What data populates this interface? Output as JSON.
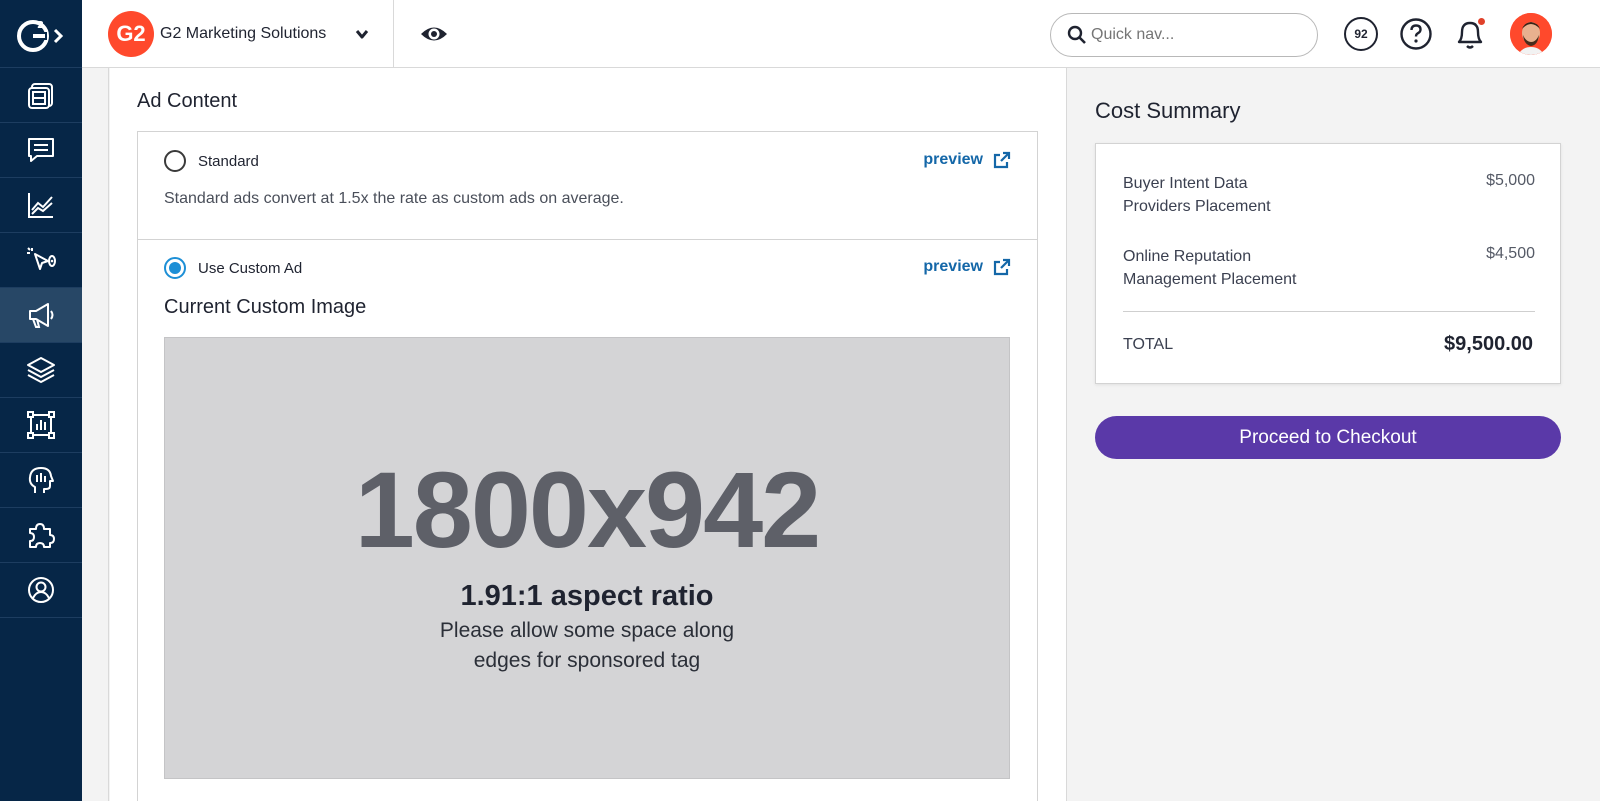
{
  "header": {
    "org_name": "G2 Marketing Solutions",
    "org_logo_text": "G2",
    "search_placeholder": "Quick nav...",
    "score_badge": "92",
    "notification_dot": true
  },
  "sidebar": {
    "logo": "G2",
    "items": [
      {
        "icon": "dashboard-icon",
        "active": false
      },
      {
        "icon": "chat-icon",
        "active": false
      },
      {
        "icon": "line-chart-icon",
        "active": false
      },
      {
        "icon": "click-target-icon",
        "active": false
      },
      {
        "icon": "megaphone-icon",
        "active": true
      },
      {
        "icon": "layers-icon",
        "active": false
      },
      {
        "icon": "report-chart-icon",
        "active": false
      },
      {
        "icon": "head-insight-icon",
        "active": false
      },
      {
        "icon": "puzzle-icon",
        "active": false
      },
      {
        "icon": "user-circle-icon",
        "active": false
      }
    ]
  },
  "main": {
    "section_title": "Ad Content",
    "standard": {
      "label": "Standard",
      "preview": "preview",
      "description": "Standard ads convert at 1.5x the rate as custom ads on average.",
      "selected": false
    },
    "custom": {
      "label": "Use Custom Ad",
      "preview": "preview",
      "selected": true,
      "image_title": "Current Custom Image",
      "placeholder_dims": "1800x942",
      "placeholder_ratio": "1.91:1 aspect ratio",
      "placeholder_note_line1": "Please allow some space along",
      "placeholder_note_line2": "edges for sponsored tag"
    }
  },
  "cost_summary": {
    "title": "Cost Summary",
    "items": [
      {
        "name_line1": "Buyer Intent Data",
        "name_line2": "Providers Placement",
        "price": "$5,000"
      },
      {
        "name_line1": "Online Reputation",
        "name_line2": "Management Placement",
        "price": "$4,500"
      }
    ],
    "total_label": "TOTAL",
    "total_value": "$9,500.00",
    "checkout_label": "Proceed to Checkout"
  },
  "colors": {
    "sidebar_bg": "#062647",
    "brand_red": "#ff492c",
    "link_blue": "#1467a8",
    "radio_blue": "#1d8fd6",
    "checkout_purple": "#5a39a8"
  }
}
